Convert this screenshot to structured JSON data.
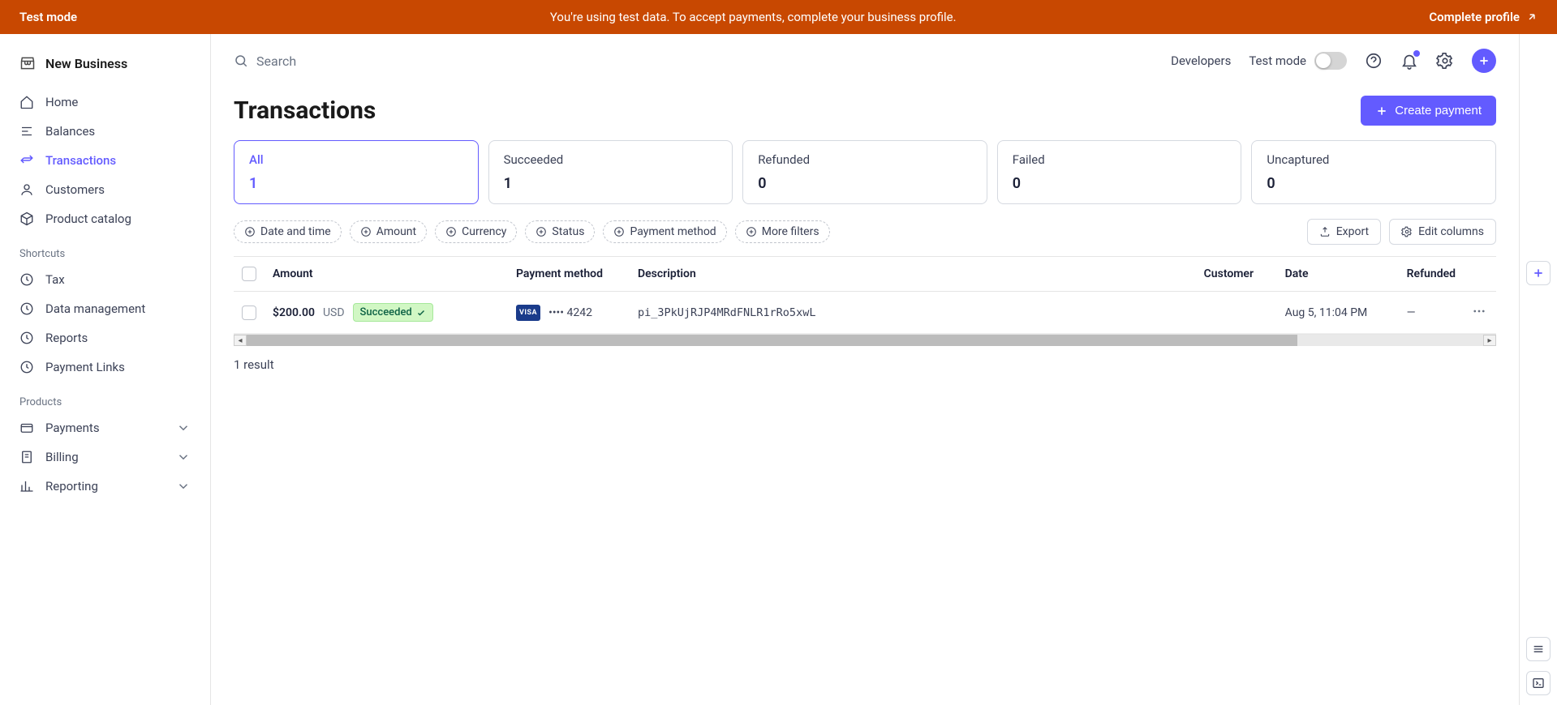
{
  "banner": {
    "mode_label": "Test mode",
    "message": "You're using test data. To accept payments, complete your business profile.",
    "cta": "Complete profile"
  },
  "business_name": "New Business",
  "nav": {
    "primary": [
      {
        "label": "Home"
      },
      {
        "label": "Balances"
      },
      {
        "label": "Transactions"
      },
      {
        "label": "Customers"
      },
      {
        "label": "Product catalog"
      }
    ],
    "shortcuts_label": "Shortcuts",
    "shortcuts": [
      {
        "label": "Tax"
      },
      {
        "label": "Data management"
      },
      {
        "label": "Reports"
      },
      {
        "label": "Payment Links"
      }
    ],
    "products_label": "Products",
    "products": [
      {
        "label": "Payments"
      },
      {
        "label": "Billing"
      },
      {
        "label": "Reporting"
      }
    ]
  },
  "topbar": {
    "search_placeholder": "Search",
    "developers": "Developers",
    "test_mode": "Test mode"
  },
  "page": {
    "title": "Transactions",
    "create_label": "Create payment"
  },
  "stats": [
    {
      "label": "All",
      "value": "1"
    },
    {
      "label": "Succeeded",
      "value": "1"
    },
    {
      "label": "Refunded",
      "value": "0"
    },
    {
      "label": "Failed",
      "value": "0"
    },
    {
      "label": "Uncaptured",
      "value": "0"
    }
  ],
  "filters": {
    "date": "Date and time",
    "amount": "Amount",
    "currency": "Currency",
    "status": "Status",
    "pm": "Payment method",
    "more": "More filters"
  },
  "actions": {
    "export": "Export",
    "edit_cols": "Edit columns"
  },
  "table": {
    "headers": {
      "amount": "Amount",
      "pm": "Payment method",
      "desc": "Description",
      "customer": "Customer",
      "date": "Date",
      "refunded": "Refunded"
    },
    "rows": [
      {
        "amount": "$200.00",
        "currency": "USD",
        "status": "Succeeded",
        "card_brand": "VISA",
        "card_last": "•••• 4242",
        "description": "pi_3PkUjRJP4MRdFNLR1rRo5xwL",
        "customer": "",
        "date": "Aug 5, 11:04 PM",
        "refunded": "—"
      }
    ]
  },
  "result_count": "1 result"
}
